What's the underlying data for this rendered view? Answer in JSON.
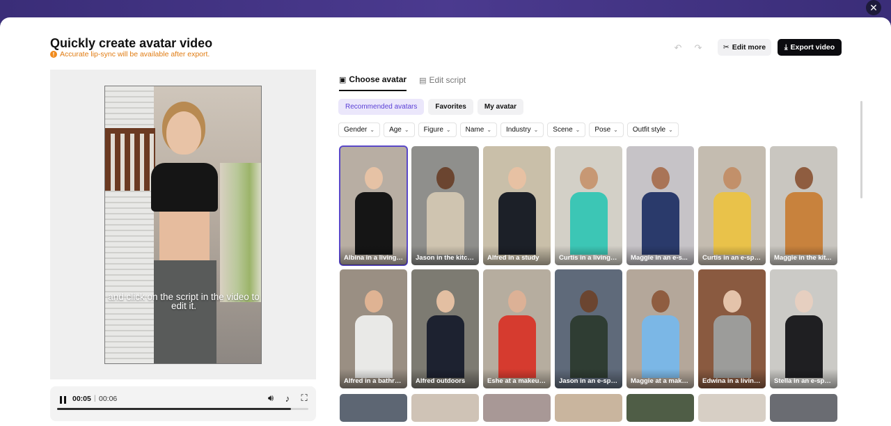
{
  "header": {
    "title": "Quickly create avatar video",
    "warning": "Accurate lip-sync will be available after export.",
    "edit_more_label": "Edit more",
    "export_label": "Export video"
  },
  "preview": {
    "caption": "and click on the script in the video to edit it."
  },
  "player": {
    "current_time": "00:05",
    "separator": "|",
    "total_time": "00:06",
    "progress": 0.93
  },
  "tabs": [
    {
      "label": "Choose avatar",
      "active": true
    },
    {
      "label": "Edit script",
      "active": false
    }
  ],
  "categories": [
    {
      "label": "Recommended avatars",
      "active": true
    },
    {
      "label": "Favorites",
      "active": false
    },
    {
      "label": "My avatar",
      "active": false
    }
  ],
  "filters": [
    "Gender",
    "Age",
    "Figure",
    "Name",
    "Industry",
    "Scene",
    "Pose",
    "Outfit style"
  ],
  "avatars": [
    {
      "label": "Albina in a living r...",
      "bg": "#b8aea3",
      "skin": "#e6c2a5",
      "cloth": "#151515",
      "selected": true
    },
    {
      "label": "Jason in the kitch...",
      "bg": "#8f8f8c",
      "skin": "#6b4530",
      "cloth": "#cfc4b0"
    },
    {
      "label": "Alfred in a study",
      "bg": "#c9bfa9",
      "skin": "#e7c1a3",
      "cloth": "#1c2028"
    },
    {
      "label": "Curtis in a living r...",
      "bg": "#d3d0c7",
      "skin": "#c79874",
      "cloth": "#3cc6b5"
    },
    {
      "label": "Maggie in an e-s...",
      "bg": "#c6c3c7",
      "skin": "#a97457",
      "cloth": "#2a3a6b"
    },
    {
      "label": "Curtis in an e-spo...",
      "bg": "#c4bcb0",
      "skin": "#c2906a",
      "cloth": "#e9c24a"
    },
    {
      "label": "Maggie in the kit...",
      "bg": "#c9c6c0",
      "skin": "#8f5d40",
      "cloth": "#c8823d"
    },
    {
      "label": "Alfred in a bathro...",
      "bg": "#9a8f83",
      "skin": "#dfb393",
      "cloth": "#e9e9e7"
    },
    {
      "label": "Alfred outdoors",
      "bg": "#7d7b72",
      "skin": "#e3bfa2",
      "cloth": "#1d2230"
    },
    {
      "label": "Eshe at a makeup...",
      "bg": "#b6ad9f",
      "skin": "#dcb196",
      "cloth": "#d63b2f"
    },
    {
      "label": "Jason in an e-spo...",
      "bg": "#5f6a7a",
      "skin": "#6b4530",
      "cloth": "#2f3d33"
    },
    {
      "label": "Maggie at a make...",
      "bg": "#b4a79a",
      "skin": "#8f5d40",
      "cloth": "#7bb7e6"
    },
    {
      "label": "Edwina in a living ...",
      "bg": "#8a5a40",
      "skin": "#e4c3aa",
      "cloth": "#9c9c9a"
    },
    {
      "label": "Stella in an e-spo...",
      "bg": "#cbcac6",
      "skin": "#e6cfc0",
      "cloth": "#1f1f22"
    }
  ],
  "avatars_row3_colors": [
    "#5d6673",
    "#cfc3b6",
    "#a89896",
    "#c9b59e",
    "#4f5d46",
    "#d7cfc5",
    "#6a6c72"
  ]
}
